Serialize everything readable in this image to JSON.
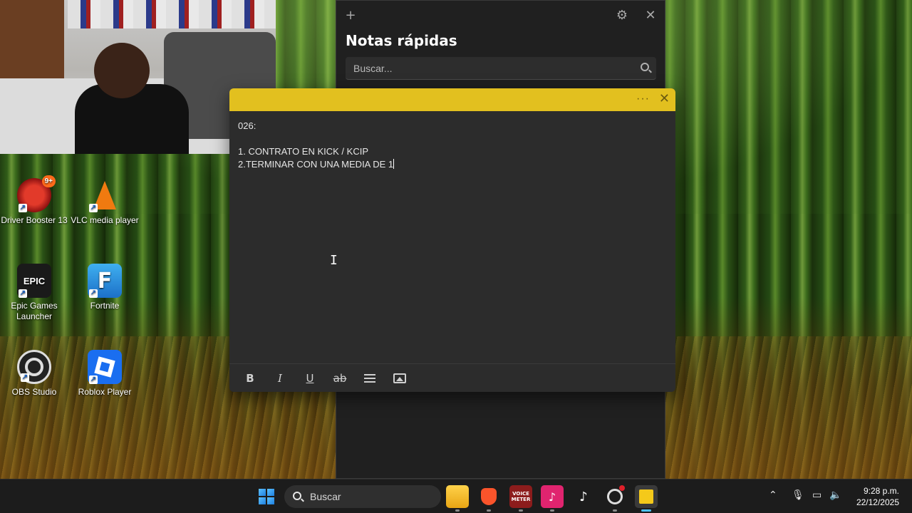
{
  "desktop": {
    "icons": [
      {
        "label": "Driver Booster 13",
        "badge": "9+"
      },
      {
        "label": "VLC media player"
      },
      {
        "label": "Epic Games Launcher",
        "glyph": "EPIC"
      },
      {
        "label": "Fortnite",
        "glyph": "F"
      },
      {
        "label": "OBS Studio"
      },
      {
        "label": "Roblox Player"
      }
    ]
  },
  "notes_window": {
    "title": "Notas rápidas",
    "search_placeholder": "Buscar...",
    "new_note_icon": "plus-icon",
    "settings_icon": "gear-icon",
    "close_icon": "close-icon"
  },
  "note": {
    "header_color": "#e2c01f",
    "lines": [
      "026:",
      "",
      "1. CONTRATO EN KICK / KCIP",
      "2.TERMINAR CON UNA MEDIA DE 1"
    ],
    "format_buttons": [
      "bold-icon",
      "italic-icon",
      "underline-icon",
      "strikethrough-icon",
      "list-icon",
      "image-icon"
    ],
    "bold_glyph": "B",
    "italic_glyph": "I",
    "underline_glyph": "U",
    "strike_glyph": "ab"
  },
  "taskbar": {
    "search_label": "Buscar",
    "apps": [
      "file-explorer-icon",
      "brave-icon",
      "voicemeeter-icon",
      "tiktok-live-icon",
      "tiktok-icon",
      "obs-icon",
      "sticky-notes-icon"
    ],
    "voicemeeter_glyph": "VOICE METER",
    "time": "9:28 p.m.",
    "date": "22/12/2025"
  }
}
